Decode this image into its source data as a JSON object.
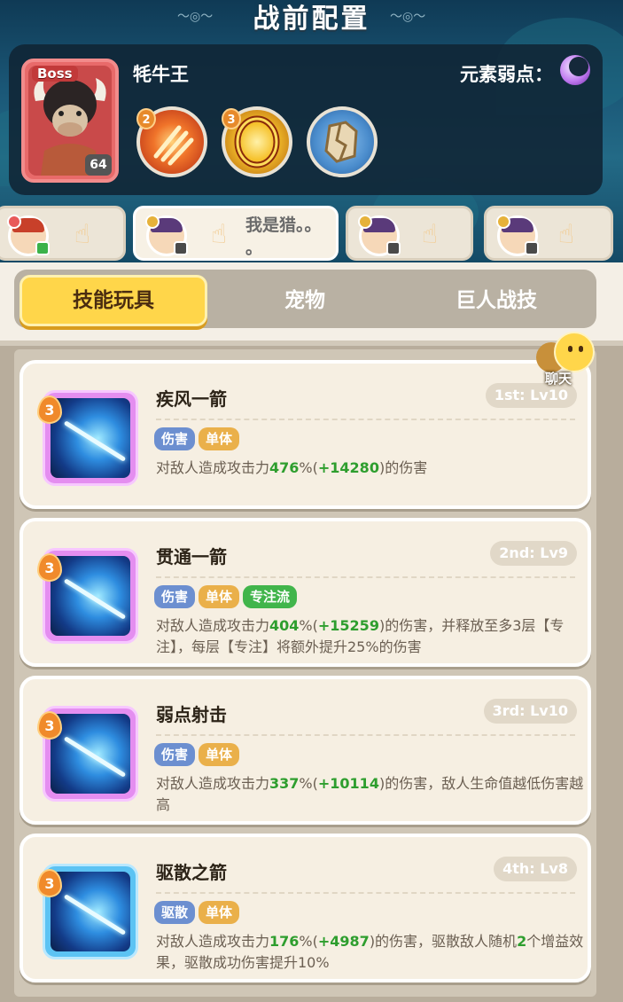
{
  "title": "战前配置",
  "boss": {
    "tag": "Boss",
    "name": "牦牛王",
    "level": "64",
    "weakness_label": "元素弱点：",
    "weakness_icon": "moon-icon",
    "skills": [
      {
        "icon": "fire-claw-icon",
        "level": "2",
        "color": "#d9461f"
      },
      {
        "icon": "fire-ring-icon",
        "level": "3",
        "color": "#f0a91c"
      },
      {
        "icon": "cracked-rock-icon",
        "level": "",
        "color": "#6a9fd0"
      }
    ]
  },
  "teammates": [
    {
      "badge": "green"
    },
    {
      "chat": "我是猎。。",
      "chat_line2": "。",
      "badge": "gray"
    },
    {
      "badge": "gray"
    },
    {
      "badge": "gray"
    }
  ],
  "tabs": [
    {
      "label": "技能玩具",
      "active": true
    },
    {
      "label": "宠物",
      "active": false
    },
    {
      "label": "巨人战技",
      "active": false
    }
  ],
  "chat_button": {
    "label": "聊天"
  },
  "skills": [
    {
      "name": "疾风一箭",
      "rank": "1st: Lv10",
      "level": "3",
      "frame": "pink",
      "tags": [
        {
          "text": "伤害",
          "color": "blue"
        },
        {
          "text": "单体",
          "color": "orange"
        }
      ],
      "desc": [
        {
          "t": "对敌人造成攻击力"
        },
        {
          "t": "476",
          "n": true
        },
        {
          "t": "%("
        },
        {
          "t": "+14280",
          "n": true
        },
        {
          "t": ")的伤害"
        }
      ]
    },
    {
      "name": "贯通一箭",
      "rank": "2nd: Lv9",
      "level": "3",
      "frame": "pink",
      "tags": [
        {
          "text": "伤害",
          "color": "blue"
        },
        {
          "text": "单体",
          "color": "orange"
        },
        {
          "text": "专注流",
          "color": "green"
        }
      ],
      "desc": [
        {
          "t": "对敌人造成攻击力"
        },
        {
          "t": "404",
          "n": true
        },
        {
          "t": "%("
        },
        {
          "t": "+15259",
          "n": true
        },
        {
          "t": ")的伤害，并释放至多3层【专注】，每层【专注】将额外提升25%的伤害"
        }
      ]
    },
    {
      "name": "弱点射击",
      "rank": "3rd: Lv10",
      "level": "3",
      "frame": "pink",
      "tags": [
        {
          "text": "伤害",
          "color": "blue"
        },
        {
          "text": "单体",
          "color": "orange"
        }
      ],
      "desc": [
        {
          "t": "对敌人造成攻击力"
        },
        {
          "t": "337",
          "n": true
        },
        {
          "t": "%("
        },
        {
          "t": "+10114",
          "n": true
        },
        {
          "t": ")的伤害，敌人生命值越低伤害越高"
        }
      ]
    },
    {
      "name": "驱散之箭",
      "rank": "4th: Lv8",
      "level": "3",
      "frame": "blue",
      "tags": [
        {
          "text": "驱散",
          "color": "blue"
        },
        {
          "text": "单体",
          "color": "orange"
        }
      ],
      "desc": [
        {
          "t": "对敌人造成攻击力"
        },
        {
          "t": "176",
          "n": true
        },
        {
          "t": "%("
        },
        {
          "t": "+4987",
          "n": true
        },
        {
          "t": ")的伤害，驱散敌人随机"
        },
        {
          "t": "2",
          "n": true
        },
        {
          "t": "个增益效果，驱散成功伤害提升10%"
        }
      ]
    }
  ]
}
